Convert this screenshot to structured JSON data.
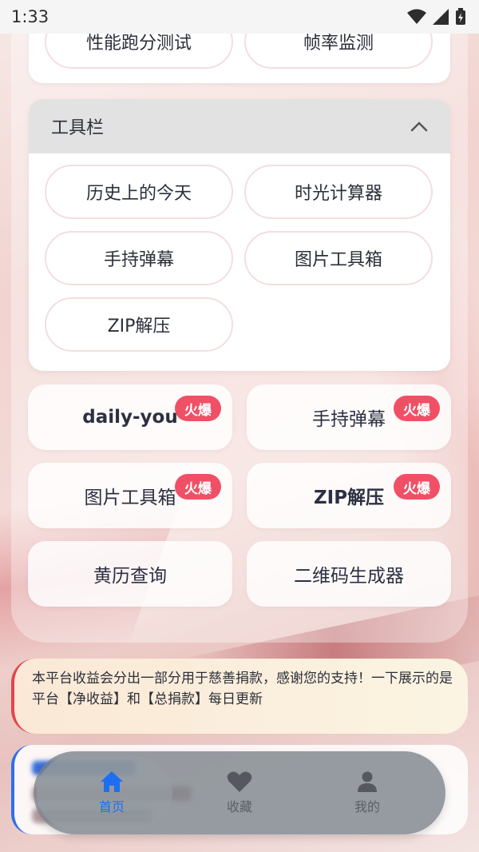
{
  "status_bar": {
    "time": "1:33"
  },
  "top_card": {
    "items": [
      "性能跑分测试",
      "帧率监测"
    ]
  },
  "toolbar": {
    "title": "工具栏",
    "items": [
      "历史上的今天",
      "时光计算器",
      "手持弹幕",
      "图片工具箱",
      "ZIP解压"
    ]
  },
  "hot_grid": {
    "badge": "火爆",
    "items": [
      {
        "label": "daily-you",
        "hot": true
      },
      {
        "label": "手持弹幕",
        "hot": true
      },
      {
        "label": "图片工具箱",
        "hot": true
      },
      {
        "label": "ZIP解压",
        "hot": true
      },
      {
        "label": "黄历查询",
        "hot": false
      },
      {
        "label": "二维码生成器",
        "hot": false
      }
    ]
  },
  "notice": {
    "text": "本平台收益会分出一部分用于慈善捐款，感谢您的支持！一下展示的是平台【净收益】和【总捐款】每日更新"
  },
  "bottom_nav": {
    "items": [
      {
        "label": "首页",
        "icon": "home-icon",
        "active": true
      },
      {
        "label": "收藏",
        "icon": "heart-icon",
        "active": false
      },
      {
        "label": "我的",
        "icon": "user-icon",
        "active": false
      }
    ]
  },
  "colors": {
    "accent": "#1e6ff0",
    "hot_badge": "#f05066",
    "notice_bar": "#e2454a"
  }
}
